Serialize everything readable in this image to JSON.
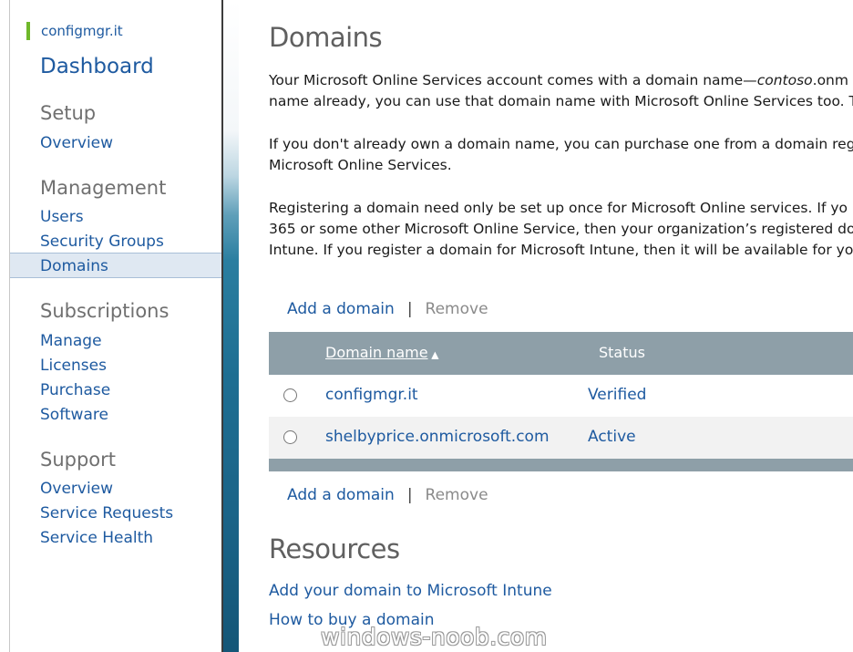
{
  "sidebar": {
    "brand": "configmgr.it",
    "dashboard": "Dashboard",
    "setup": {
      "heading": "Setup",
      "items": [
        "Overview"
      ]
    },
    "management": {
      "heading": "Management",
      "items": [
        "Users",
        "Security Groups",
        "Domains"
      ],
      "selected": "Domains"
    },
    "subscriptions": {
      "heading": "Subscriptions",
      "items": [
        "Manage",
        "Licenses",
        "Purchase",
        "Software"
      ]
    },
    "support": {
      "heading": "Support",
      "items": [
        "Overview",
        "Service Requests",
        "Service Health"
      ]
    }
  },
  "main": {
    "title": "Domains",
    "para1": {
      "line1_a": "Your Microsoft Online Services account comes with a domain name—",
      "line1_i": "contoso",
      "line1_b": ".onm",
      "line2": "name already, you can use that domain name with Microsoft Online Services too. T"
    },
    "para2": {
      "line1": "If you don't already own a domain name, you can purchase one from a domain reg",
      "line2": "Microsoft Online Services."
    },
    "para3": {
      "line1": "Registering a domain need only be set up once for Microsoft Online services. If yo",
      "line2": "365 or some other Microsoft Online Service, then your organization’s registered do",
      "line3": "Intune. If you register a domain for Microsoft Intune, then it will be available for yo"
    },
    "actions": {
      "add": "Add a domain",
      "separator": "|",
      "remove": "Remove"
    },
    "table": {
      "columns": {
        "name": "Domain name",
        "sort_indicator": "▲",
        "status": "Status"
      },
      "rows": [
        {
          "name": "configmgr.it",
          "status": "Verified"
        },
        {
          "name": "shelbyprice.onmicrosoft.com",
          "status": "Active"
        }
      ]
    },
    "resources": {
      "title": "Resources",
      "links": [
        "Add your domain to Microsoft Intune",
        "How to buy a domain"
      ]
    }
  },
  "watermark": "windows-noob.com",
  "colors": {
    "accent": "#1e5aa0",
    "brand_bar": "#6fb82a",
    "table_header": "#8e9fa8",
    "selected_bg": "#dfe8f2"
  }
}
